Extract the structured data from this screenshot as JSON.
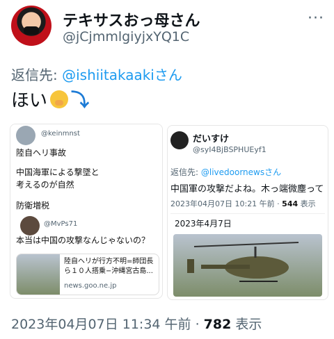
{
  "author": {
    "name": "テキサスおっ母さん",
    "handle": "@jCjmmlgiyjxYQ1C"
  },
  "menu_icon": "more-horizontal-icon",
  "reply_to": {
    "label": "返信先: ",
    "target": "@ishiitakaaki",
    "suffix": "さん"
  },
  "tweet_text": "ほい",
  "quoted_left": {
    "top_handle": "@keinmnst",
    "lines": [
      "陸自ヘリ事故",
      "中国海軍による撃墜と",
      "考えるのが自然",
      "防衛増税"
    ],
    "reply_handle": "@MvPs71",
    "reply_text": "本当は中国の攻撃なんじゃないの？",
    "link_title": "陸自ヘリが行方不明=師団長ら１０人搭乗−沖縄宮古島...",
    "link_domain": "news.goo.ne.jp"
  },
  "quoted_right": {
    "name": "だいすけ",
    "handle": "@syI4BjBSPHUEyf1",
    "reply_label": "返信先: ",
    "reply_target": "@livedoornews",
    "reply_suffix": "さん",
    "text": "中国軍の攻撃だよね。木っ端微塵って",
    "time": "2023年04月07日 10:21 午前 · ",
    "views_number": "544",
    "views_label": " 表示",
    "image_caption": "2023年4月7日"
  },
  "footer": {
    "time": "2023年04月07日 11:34 午前 · ",
    "views_number": "782",
    "views_label": " 表示"
  }
}
